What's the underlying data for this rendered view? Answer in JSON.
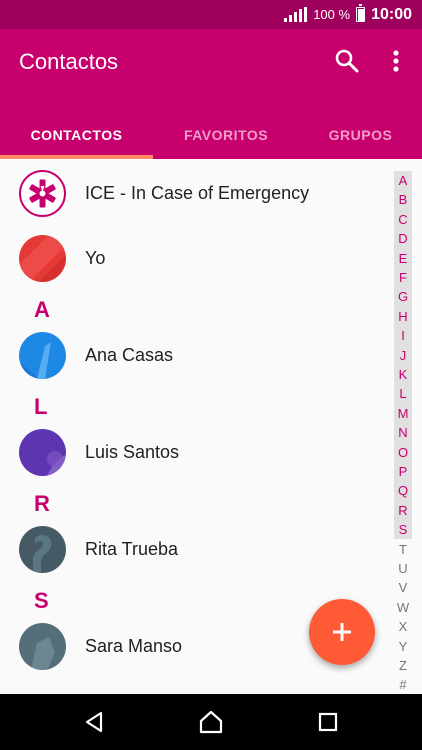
{
  "status_bar": {
    "battery": "100 %",
    "time": "10:00"
  },
  "app_bar": {
    "title": "Contactos"
  },
  "tabs": [
    {
      "label": "CONTACTOS",
      "active": true
    },
    {
      "label": "FAVORITOS",
      "active": false
    },
    {
      "label": "GRUPOS",
      "active": false
    }
  ],
  "ice": {
    "label": "ICE - In Case of Emergency"
  },
  "me": {
    "label": "Yo"
  },
  "sections": [
    {
      "letter": "A",
      "contact": "Ana Casas"
    },
    {
      "letter": "L",
      "contact": "Luis Santos"
    },
    {
      "letter": "R",
      "contact": "Rita Trueba"
    },
    {
      "letter": "S",
      "contact": "Sara Manso"
    }
  ],
  "index": [
    "A",
    "B",
    "C",
    "D",
    "E",
    "F",
    "G",
    "H",
    "I",
    "J",
    "K",
    "L",
    "M",
    "N",
    "O",
    "P",
    "Q",
    "R",
    "S",
    "T",
    "U",
    "V",
    "W",
    "X",
    "Y",
    "Z",
    "#"
  ],
  "colors": {
    "accent": "#c8006e",
    "status_bar": "#a0005d",
    "fab": "#ff5a36",
    "tab_indicator": "#ff8a65"
  },
  "icons": {
    "search": "search-icon",
    "more": "more-vert-icon",
    "add": "add-icon",
    "back": "back-icon",
    "home": "home-icon",
    "recents": "recents-icon"
  }
}
